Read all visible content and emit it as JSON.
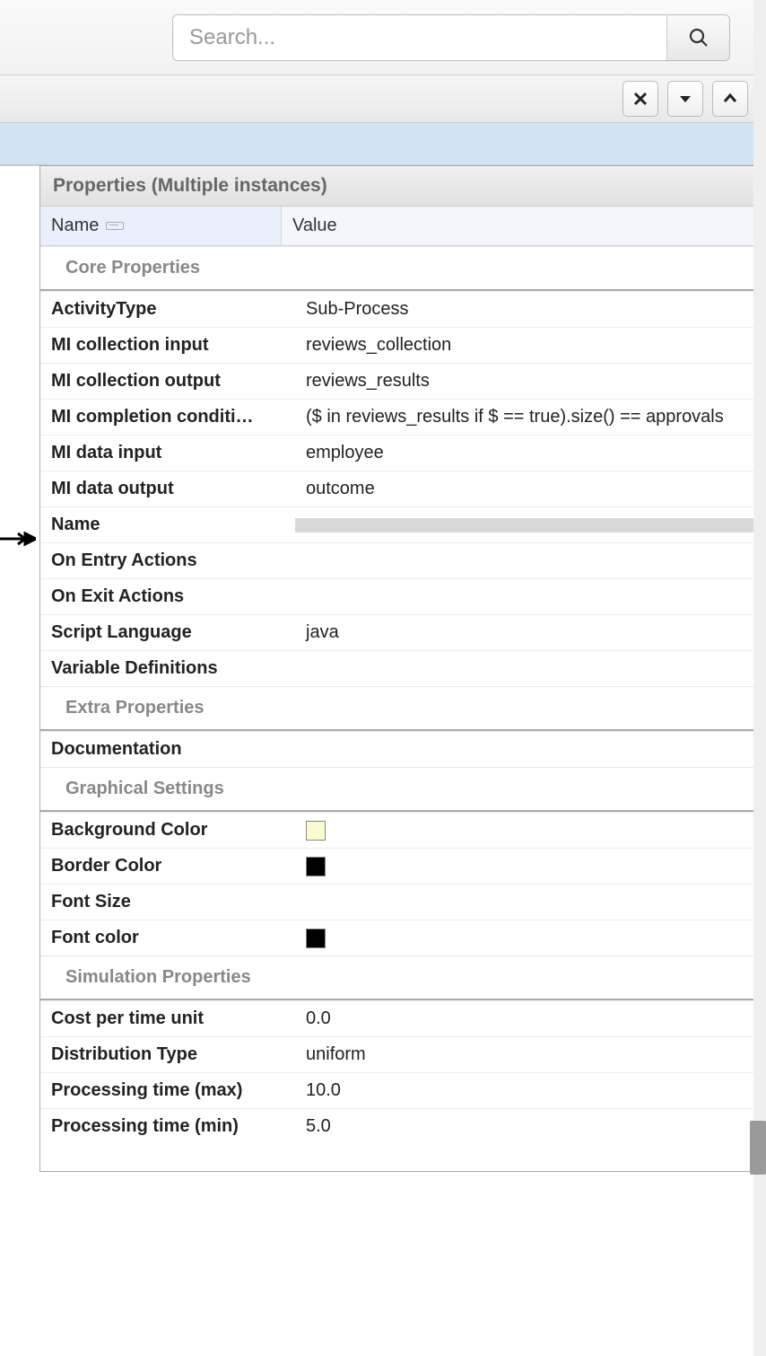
{
  "search": {
    "placeholder": "Search..."
  },
  "panel": {
    "title": "Properties (Multiple instances)",
    "columns": {
      "name": "Name",
      "value": "Value"
    }
  },
  "sections": {
    "core": "Core Properties",
    "extra": "Extra Properties",
    "graphical": "Graphical Settings",
    "simulation": "Simulation Properties"
  },
  "core": [
    {
      "name": "ActivityType",
      "value": "Sub-Process"
    },
    {
      "name": "MI collection input",
      "value": "reviews_collection"
    },
    {
      "name": "MI collection output",
      "value": "reviews_results"
    },
    {
      "name": "MI completion conditi…",
      "value": "($ in reviews_results if $ == true).size() == approvals"
    },
    {
      "name": "MI data input",
      "value": "employee"
    },
    {
      "name": "MI data output",
      "value": "outcome"
    },
    {
      "name": "Name",
      "value": "",
      "highlight": true
    },
    {
      "name": "On Entry Actions",
      "value": ""
    },
    {
      "name": "On Exit Actions",
      "value": ""
    },
    {
      "name": "Script Language",
      "value": "java"
    },
    {
      "name": "Variable Definitions",
      "value": ""
    }
  ],
  "extra": [
    {
      "name": "Documentation",
      "value": ""
    }
  ],
  "graphical": [
    {
      "name": "Background Color",
      "swatch": "#fbfbd0"
    },
    {
      "name": "Border Color",
      "swatch": "#000000"
    },
    {
      "name": "Font Size",
      "value": ""
    },
    {
      "name": "Font color",
      "swatch": "#000000"
    }
  ],
  "simulation": [
    {
      "name": "Cost per time unit",
      "value": "0.0"
    },
    {
      "name": "Distribution Type",
      "value": "uniform"
    },
    {
      "name": "Processing time (max)",
      "value": "10.0"
    },
    {
      "name": "Processing time (min)",
      "value": "5.0"
    }
  ]
}
